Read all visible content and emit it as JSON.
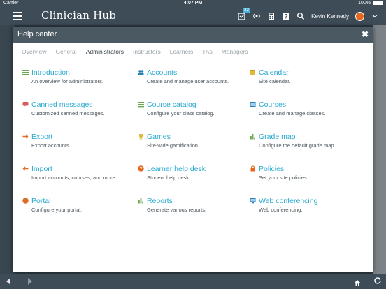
{
  "status_bar": {
    "carrier": "Carrier",
    "time": "4:07 PM",
    "battery": "100%"
  },
  "app": {
    "title": "Clinician Hub",
    "notification_count": "22",
    "user_name": "Kevin Kennedy"
  },
  "modal": {
    "title": "Help center",
    "close_label": "✖",
    "tabs": [
      {
        "label": "Overview"
      },
      {
        "label": "General"
      },
      {
        "label": "Administrators"
      },
      {
        "label": "Instructors"
      },
      {
        "label": "Learners"
      },
      {
        "label": "TAs"
      },
      {
        "label": "Managers"
      }
    ],
    "active_tab": "Administrators",
    "items": [
      {
        "title": "Introduction",
        "desc": "An overview for administrators.",
        "icon": "list-icon",
        "color": "#6aa84f"
      },
      {
        "title": "Accounts",
        "desc": "Create and manage user accounts.",
        "icon": "users-icon",
        "color": "#2a7fb8"
      },
      {
        "title": "Calendar",
        "desc": "Site calendar.",
        "icon": "calendar-icon",
        "color": "#e2b93b"
      },
      {
        "title": "Canned messages",
        "desc": "Customized canned messages.",
        "icon": "chat-icon",
        "color": "#d85a5a"
      },
      {
        "title": "Course catalog",
        "desc": "Configure your class catalog.",
        "icon": "list-icon",
        "color": "#6aa84f"
      },
      {
        "title": "Courses",
        "desc": "Create and manage classes.",
        "icon": "window-icon",
        "color": "#2a7fb8"
      },
      {
        "title": "Export",
        "desc": "Export accounts.",
        "icon": "arrow-right-icon",
        "color": "#e8671f"
      },
      {
        "title": "Games",
        "desc": "Site-wide gamification.",
        "icon": "trophy-icon",
        "color": "#e2b93b"
      },
      {
        "title": "Grade map",
        "desc": "Configure the default grade map.",
        "icon": "bar-chart-icon",
        "color": "#6aa84f"
      },
      {
        "title": "Import",
        "desc": "Import accounts, courses, and more.",
        "icon": "arrow-left-icon",
        "color": "#e8671f"
      },
      {
        "title": "Learner help desk",
        "desc": "Student help desk.",
        "icon": "help-icon",
        "color": "#e8671f"
      },
      {
        "title": "Policies",
        "desc": "Set your site policies.",
        "icon": "lock-icon",
        "color": "#e8671f"
      },
      {
        "title": "Portal",
        "desc": "Configure your portal.",
        "icon": "globe-icon",
        "color": "#e8671f"
      },
      {
        "title": "Reports",
        "desc": "Generate various reports.",
        "icon": "bar-chart-icon",
        "color": "#6aa84f"
      },
      {
        "title": "Web conferencing",
        "desc": "Web conferencing.",
        "icon": "monitor-icon",
        "color": "#2a7fb8"
      }
    ]
  }
}
